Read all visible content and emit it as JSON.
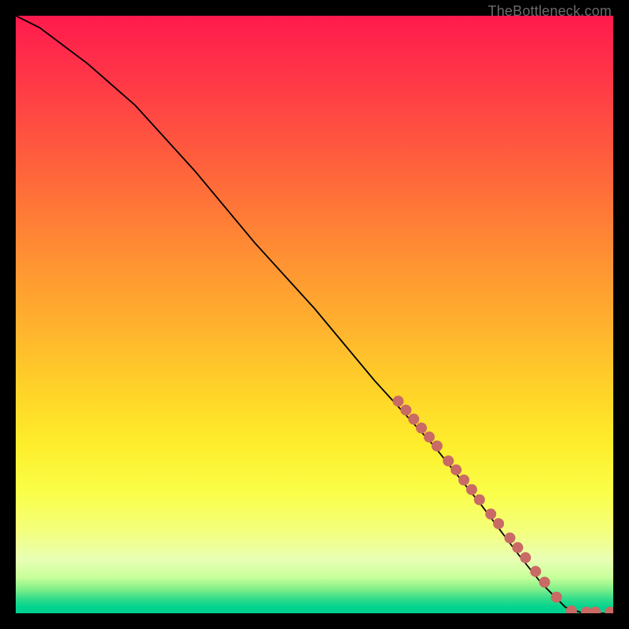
{
  "watermark": "TheBottleneck.com",
  "colors": {
    "dot": "#c96a64",
    "curve": "#000000"
  },
  "chart_data": {
    "type": "line",
    "title": "",
    "xlabel": "",
    "ylabel": "",
    "xlim": [
      0,
      100
    ],
    "ylim": [
      0,
      100
    ],
    "grid": false,
    "series": [
      {
        "name": "bottleneck-curve",
        "x": [
          0,
          4,
          8,
          12,
          20,
          30,
          40,
          50,
          60,
          70,
          78,
          84,
          88,
          92,
          95,
          98,
          100
        ],
        "y": [
          100,
          98,
          95,
          92,
          85,
          74,
          62,
          51,
          39,
          28,
          18,
          10,
          5,
          1,
          0,
          0,
          0
        ]
      }
    ],
    "dot_cluster": {
      "name": "highlighted-range",
      "points": [
        {
          "x": 64.0,
          "y": 35.5
        },
        {
          "x": 65.3,
          "y": 34.0
        },
        {
          "x": 66.6,
          "y": 32.5
        },
        {
          "x": 67.9,
          "y": 31.0
        },
        {
          "x": 69.2,
          "y": 29.5
        },
        {
          "x": 70.5,
          "y": 28.0
        },
        {
          "x": 72.4,
          "y": 25.5
        },
        {
          "x": 73.7,
          "y": 24.0
        },
        {
          "x": 75.0,
          "y": 22.3
        },
        {
          "x": 76.3,
          "y": 20.7
        },
        {
          "x": 77.6,
          "y": 19.0
        },
        {
          "x": 79.5,
          "y": 16.6
        },
        {
          "x": 80.8,
          "y": 15.0
        },
        {
          "x": 82.7,
          "y": 12.6
        },
        {
          "x": 84.0,
          "y": 11.0
        },
        {
          "x": 85.3,
          "y": 9.3
        },
        {
          "x": 87.0,
          "y": 7.0
        },
        {
          "x": 88.5,
          "y": 5.2
        },
        {
          "x": 90.5,
          "y": 2.7
        },
        {
          "x": 93.0,
          "y": 0.4
        },
        {
          "x": 95.5,
          "y": 0.2
        },
        {
          "x": 97.0,
          "y": 0.2
        },
        {
          "x": 99.5,
          "y": 0.2
        }
      ],
      "radius_px": 7
    }
  }
}
